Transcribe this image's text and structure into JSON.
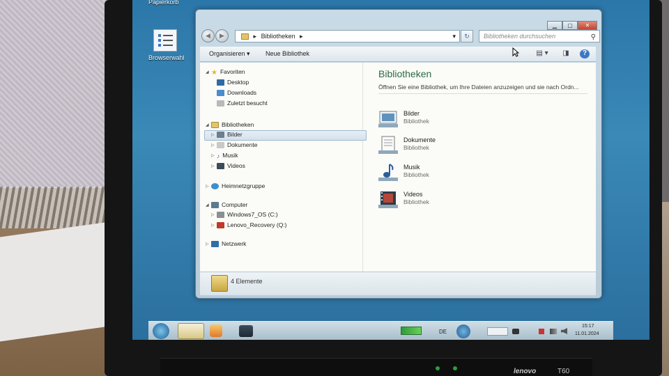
{
  "desktop": {
    "recycle_bin_label": "Papierkorb",
    "browser_choice_label": "Browserwahl"
  },
  "window": {
    "buttons": {
      "minimize": "▁",
      "maximize": "▢",
      "close": "✕"
    },
    "address": {
      "root_arrow": "▸",
      "path": "Bibliotheken",
      "path_arrow": "▸",
      "dropdown": "▾"
    },
    "refresh_glyph": "↻",
    "search": {
      "placeholder": "Bibliotheken durchsuchen",
      "icon": "search-icon"
    },
    "toolbar": {
      "organize": "Organisieren ▾",
      "new_library": "Neue Bibliothek",
      "view_glyph": "▤ ▾",
      "preview_glyph": "◨",
      "help_glyph": "?"
    },
    "nav": {
      "favorites": "Favoriten",
      "favorites_items": [
        "Desktop",
        "Downloads",
        "Zuletzt besucht"
      ],
      "libraries": "Bibliotheken",
      "libraries_items": [
        "Bilder",
        "Dokumente",
        "Musik",
        "Videos"
      ],
      "homegroup": "Heimnetzgruppe",
      "computer": "Computer",
      "computer_items": [
        "Windows7_OS (C:)",
        "Lenovo_Recovery (Q:)"
      ],
      "network": "Netzwerk"
    },
    "main": {
      "title": "Bibliotheken",
      "subtitle": "Öffnen Sie eine Bibliothek, um Ihre Dateien anzuzeigen und sie nach Ordn...",
      "libraries": [
        {
          "name": "Bilder",
          "kind": "Bibliothek"
        },
        {
          "name": "Dokumente",
          "kind": "Bibliothek"
        },
        {
          "name": "Musik",
          "kind": "Bibliothek"
        },
        {
          "name": "Videos",
          "kind": "Bibliothek"
        }
      ]
    },
    "status": {
      "count": "4 Elemente"
    }
  },
  "taskbar": {
    "language": "DE",
    "time": "15:17",
    "date": "11.01.2024"
  },
  "laptop": {
    "brand": "lenovo",
    "model": "T60"
  }
}
